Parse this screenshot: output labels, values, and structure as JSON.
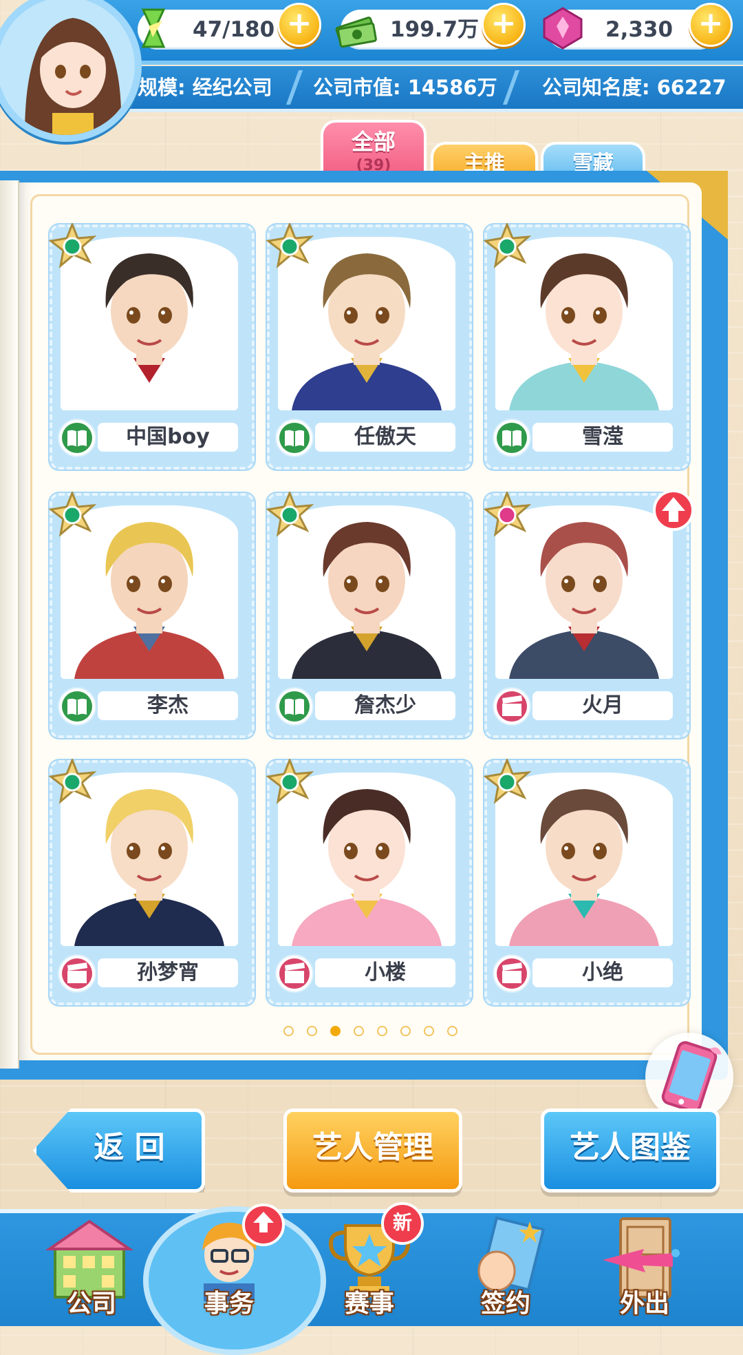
{
  "hud": {
    "energy": "47/180",
    "money": "199.7万",
    "gems": "2,330",
    "plus": "+",
    "scale": "规模: 经纪公司",
    "market_value": "公司市值: 14586万",
    "fame": "公司知名度: 66227"
  },
  "tabs": {
    "all": "全部",
    "all_count": "(39)",
    "featured": "主推",
    "hidden": "雪藏"
  },
  "cards": [
    {
      "name": "中国boy",
      "type_icon": "book-icon",
      "star_color": "#1aa86a",
      "upgrade": false,
      "hair": "#3a2e28",
      "skin": "#f6d8c0",
      "cloth": "#ffffff",
      "accent": "#b3222c"
    },
    {
      "name": "任傲天",
      "type_icon": "book-icon",
      "star_color": "#1aa86a",
      "upgrade": false,
      "hair": "#8a6a3c",
      "skin": "#f7dcc4",
      "cloth": "#2f3e8e",
      "accent": "#e1b33b"
    },
    {
      "name": "雪滢",
      "type_icon": "book-icon",
      "star_color": "#1aa86a",
      "upgrade": false,
      "hair": "#5c3a2a",
      "skin": "#fbe2d2",
      "cloth": "#8fd6d9",
      "accent": "#f0c23c"
    },
    {
      "name": "李杰",
      "type_icon": "book-icon",
      "star_color": "#1aa86a",
      "upgrade": false,
      "hair": "#e9c653",
      "skin": "#f5d5bb",
      "cloth": "#c0423f",
      "accent": "#5070a0"
    },
    {
      "name": "詹杰少",
      "type_icon": "book-icon",
      "star_color": "#1aa86a",
      "upgrade": false,
      "hair": "#6a3a2c",
      "skin": "#f6d6c0",
      "cloth": "#2b2e3a",
      "accent": "#d4a32c"
    },
    {
      "name": "火月",
      "type_icon": "clapper-icon",
      "star_color": "#e03a8a",
      "upgrade": true,
      "hair": "#a9504a",
      "skin": "#f7dccb",
      "cloth": "#3c4b66",
      "accent": "#b82e32"
    },
    {
      "name": "孙梦宵",
      "type_icon": "clapper-icon",
      "star_color": "#1aa86a",
      "upgrade": false,
      "hair": "#f0d067",
      "skin": "#f7dcc6",
      "cloth": "#1f2c4f",
      "accent": "#d4a32c"
    },
    {
      "name": "小楼",
      "type_icon": "clapper-icon",
      "star_color": "#1aa86a",
      "upgrade": false,
      "hair": "#4a2c26",
      "skin": "#fbe2d4",
      "cloth": "#f6a9c0",
      "accent": "#f2c34a"
    },
    {
      "name": "小绝",
      "type_icon": "clapper-icon",
      "star_color": "#1aa86a",
      "upgrade": false,
      "hair": "#6a4a3a",
      "skin": "#f7dcc8",
      "cloth": "#f0a0b4",
      "accent": "#2bb9b0"
    }
  ],
  "pagination": {
    "total": 8,
    "active": 3
  },
  "buttons": {
    "back": "返 回",
    "manage": "艺人管理",
    "catalog": "艺人图鉴"
  },
  "nav": [
    {
      "label": "公司",
      "icon": "building-icon",
      "badge": ""
    },
    {
      "label": "事务",
      "icon": "manager-icon",
      "badge": "arrow"
    },
    {
      "label": "赛事",
      "icon": "trophy-icon",
      "badge": "新"
    },
    {
      "label": "签约",
      "icon": "contract-icon",
      "badge": ""
    },
    {
      "label": "外出",
      "icon": "door-icon",
      "badge": ""
    }
  ],
  "colors": {
    "accent_blue": "#2e97e0",
    "tab_pink": "#f56f8e",
    "tab_orange": "#f9b233",
    "tab_blue": "#6fc3f1",
    "badge_red": "#ef3d4d"
  }
}
